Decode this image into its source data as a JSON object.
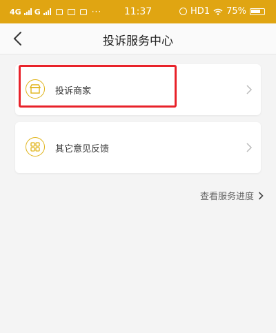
{
  "status_bar": {
    "network_1": "4G",
    "network_2": "G",
    "time": "11:37",
    "hd_label": "HD1",
    "battery": "75%"
  },
  "header": {
    "title": "投诉服务中心",
    "back_icon": "chevron-left-icon"
  },
  "menu": {
    "items": [
      {
        "label": "投诉商家",
        "icon": "shop-icon"
      },
      {
        "label": "其它意见反馈",
        "icon": "grid-icon"
      }
    ]
  },
  "footer_link": {
    "label": "查看服务进度"
  },
  "colors": {
    "status_bar": "#e0a512",
    "icon_accent": "#e0b318",
    "highlight": "#e8222a"
  }
}
